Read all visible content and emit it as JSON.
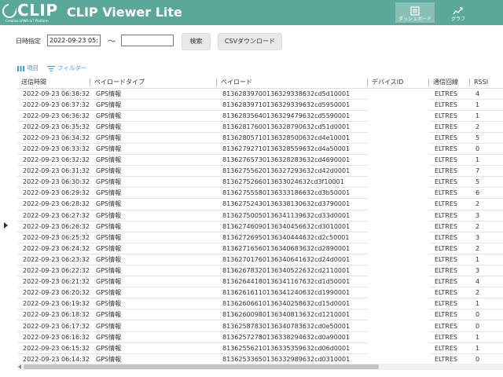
{
  "header": {
    "logo_text": "CLIP",
    "logo_sub": "Creative LPWA IoT Platform",
    "app_title": "CLIP Viewer Lite",
    "nav": [
      {
        "label": "ダッシュボード",
        "icon": "dashboard-icon",
        "active": true
      },
      {
        "label": "グラフ",
        "icon": "chart-icon",
        "active": false
      }
    ]
  },
  "filter": {
    "label": "日時指定",
    "start_value": "2022-09-23 05:44",
    "tilde": "〜",
    "end_value": "",
    "search_label": "検索",
    "csv_label": "CSVダウンロード"
  },
  "toolbar": {
    "columns_label": "項目",
    "filter_label": "フィルター"
  },
  "table": {
    "columns": [
      "送信時間",
      "ペイロードタイプ",
      "ペイロード",
      "デバイスID",
      "通信回線",
      "RSSI"
    ],
    "rows": [
      [
        "2022-09-23 06:38:32",
        "GPS情報",
        "81362839700136329338632cd5d10001",
        "",
        "ELTRES",
        "4"
      ],
      [
        "2022-09-23 06:37:32",
        "GPS情報",
        "81362839710136329339632cd5950001",
        "",
        "ELTRES",
        "1"
      ],
      [
        "2022-09-23 06:36:32",
        "GPS情報",
        "81362835640136329479632cd5590001",
        "",
        "ELTRES",
        "1"
      ],
      [
        "2022-09-23 06:35:32",
        "GPS情報",
        "81362817600136328790632cd51d0001",
        "",
        "ELTRES",
        "2"
      ],
      [
        "2022-09-23 06:34:32",
        "GPS情報",
        "81362805710136328500632cd4e10001",
        "",
        "ELTRES",
        "5"
      ],
      [
        "2022-09-23 06:33:32",
        "GPS情報",
        "81362792710136328559632cd4a50001",
        "",
        "ELTRES",
        "0"
      ],
      [
        "2022-09-23 06:32:32",
        "GPS情報",
        "81362765730136328283632cd4690001",
        "",
        "ELTRES",
        "1"
      ],
      [
        "2022-09-23 06:31:32",
        "GPS情報",
        "81362755620136327293632cd42d0001",
        "",
        "ELTRES",
        "7"
      ],
      [
        "2022-09-23 06:30:32",
        "GPS情報",
        "8136275266013633024632cd3f10001",
        "",
        "ELTRES",
        "5"
      ],
      [
        "2022-09-23 06:29:32",
        "GPS情報",
        "81362755580136333186632cd3b50001",
        "",
        "ELTRES",
        "6"
      ],
      [
        "2022-09-23 06:28:32",
        "GPS情報",
        "81362752430136338130632cd3790001",
        "",
        "ELTRES",
        "2"
      ],
      [
        "2022-09-23 06:27:32",
        "GPS情報",
        "81362750050136341139632cd33d0001",
        "",
        "ELTRES",
        "3"
      ],
      [
        "2022-09-23 06:26:32",
        "GPS情報",
        "81362746090136340456632cd3010001",
        "",
        "ELTRES",
        "2"
      ],
      [
        "2022-09-23 06:25:32",
        "GPS情報",
        "81362726950136340444632cd2c50001",
        "",
        "ELTRES",
        "3"
      ],
      [
        "2022-09-23 06:24:32",
        "GPS情報",
        "81362716560136340683632cd2890001",
        "",
        "ELTRES",
        "2"
      ],
      [
        "2022-09-23 06:23:32",
        "GPS情報",
        "81362701760136340641632cd24d0001",
        "",
        "ELTRES",
        "1"
      ],
      [
        "2022-09-23 06:22:32",
        "GPS情報",
        "81362678320136340522632cd2110001",
        "",
        "ELTRES",
        "3"
      ],
      [
        "2022-09-23 06:21:32",
        "GPS情報",
        "81362644180136341167632cd1d50001",
        "",
        "ELTRES",
        "4"
      ],
      [
        "2022-09-23 06:20:32",
        "GPS情報",
        "81362616110136341240632cd1990001",
        "",
        "ELTRES",
        "2"
      ],
      [
        "2022-09-23 06:19:32",
        "GPS情報",
        "81362606610136340258632cd15d0001",
        "",
        "ELTRES",
        "1"
      ],
      [
        "2022-09-23 06:18:32",
        "GPS情報",
        "81362600980136340813632cd1210001",
        "",
        "ELTRES",
        "0"
      ],
      [
        "2022-09-23 06:17:32",
        "GPS情報",
        "81362587830136340783632cd0e50001",
        "",
        "ELTRES",
        "0"
      ],
      [
        "2022-09-23 06:16:32",
        "GPS情報",
        "81362572780136338294632cd0a90001",
        "",
        "ELTRES",
        "1"
      ],
      [
        "2022-09-23 06:15:32",
        "GPS情報",
        "81362556210136335359632cd06d0001",
        "",
        "ELTRES",
        "1"
      ],
      [
        "2022-09-23 06:14:32",
        "GPS情報",
        "81362533650136332989632cd0310001",
        "",
        "ELTRES",
        "0"
      ]
    ]
  },
  "colors": {
    "header_bg": "#5aa89a",
    "accent": "#4a9ecf"
  }
}
